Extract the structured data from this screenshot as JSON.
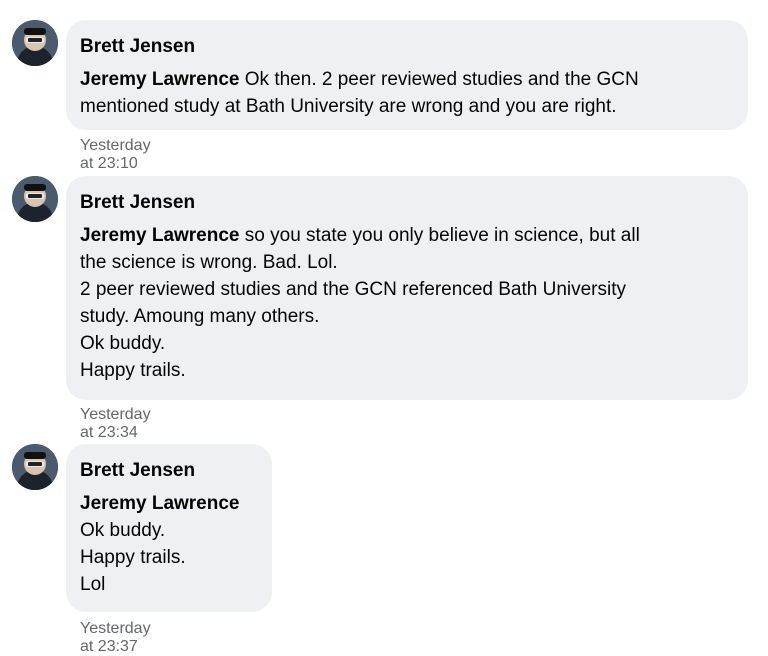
{
  "comments": [
    {
      "author": "Brett Jensen",
      "mention": "Jeremy Lawrence",
      "lines": [
        " Ok then. 2 peer reviewed studies and the GCN",
        "mentioned study at Bath University are wrong and you are right."
      ],
      "timestamp": "Yesterday at 23:10"
    },
    {
      "author": "Brett Jensen",
      "mention": "Jeremy Lawrence",
      "lines": [
        " so you state you only believe in science, but all",
        "the science is wrong. Bad. Lol.",
        "2 peer reviewed studies and the GCN referenced Bath University",
        "study. Amoung many others.",
        "Ok buddy.",
        "Happy trails."
      ],
      "timestamp": "Yesterday at 23:34"
    },
    {
      "author": "Brett Jensen",
      "mention": "Jeremy Lawrence",
      "lines": [
        "",
        "Ok buddy.",
        "Happy trails.",
        "Lol"
      ],
      "timestamp": "Yesterday at 23:37"
    }
  ]
}
